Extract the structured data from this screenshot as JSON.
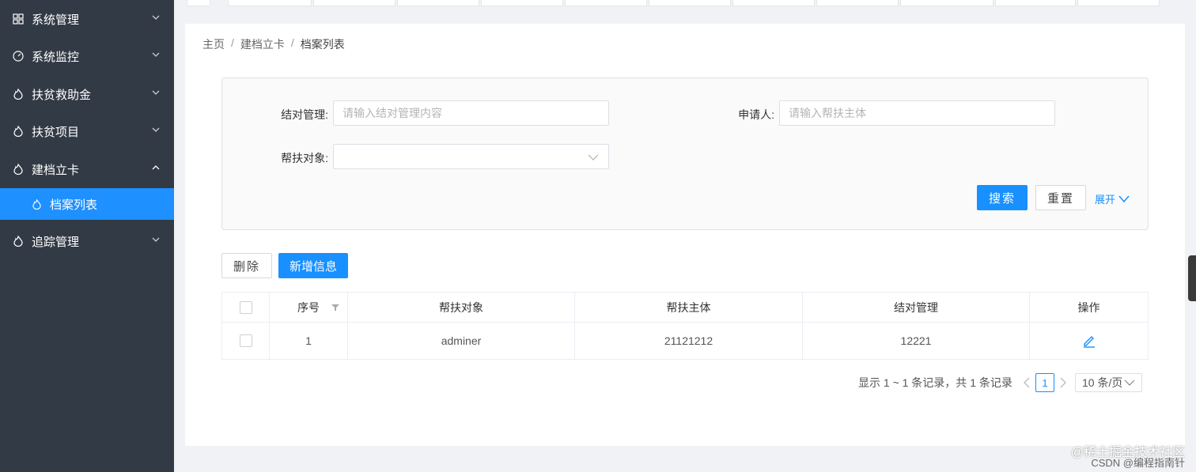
{
  "sidebar": {
    "items": [
      {
        "label": "系统管理",
        "icon": "grid-icon"
      },
      {
        "label": "系统监控",
        "icon": "gauge-icon"
      },
      {
        "label": "扶贫救助金",
        "icon": "flame-icon"
      },
      {
        "label": "扶贫项目",
        "icon": "flame-icon"
      },
      {
        "label": "建档立卡",
        "icon": "flame-icon",
        "expanded": true
      },
      {
        "label": "追踪管理",
        "icon": "flame-icon"
      }
    ],
    "active_subitem": {
      "label": "档案列表",
      "icon": "flame-icon"
    },
    "background": "#323a45",
    "active_color": "#1e90ff"
  },
  "breadcrumb": [
    "主页",
    "建档立卡",
    "档案列表"
  ],
  "breadcrumb_sep": "/",
  "search": {
    "field1_label": "结对管理:",
    "field1_placeholder": "请输入结对管理内容",
    "field2_label": "申请人:",
    "field2_placeholder": "请输入帮扶主体",
    "field3_label": "帮扶对象:",
    "search_button": "搜索",
    "reset_button": "重置",
    "expand_link": "展开"
  },
  "toolbar": {
    "delete_button": "删除",
    "add_button": "新增信息"
  },
  "table": {
    "columns": [
      "序号",
      "帮扶对象",
      "帮扶主体",
      "结对管理",
      "操作"
    ],
    "rows": [
      {
        "index": "1",
        "target": "adminer",
        "subject": "21121212",
        "pairing": "12221"
      }
    ]
  },
  "pagination": {
    "summary": "显示 1 ~ 1 条记录，共 1 条记录",
    "current_page": "1",
    "page_size": "10 条/页"
  },
  "watermark": {
    "line1": "@稀土掘金技术社区",
    "line2": "CSDN @编程指南针"
  },
  "colors": {
    "primary": "#1890ff"
  }
}
